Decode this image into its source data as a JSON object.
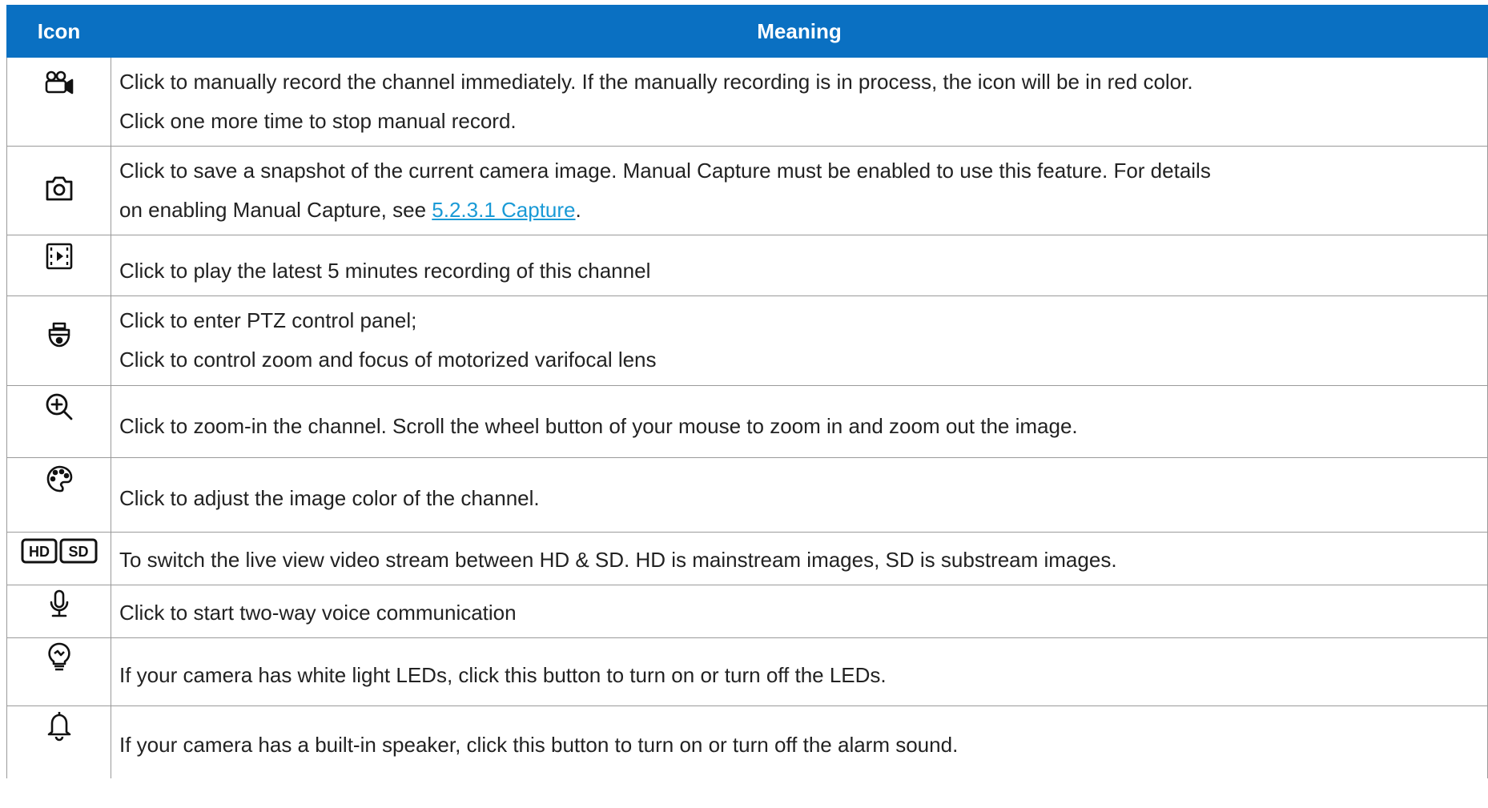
{
  "table": {
    "headers": {
      "icon": "Icon",
      "meaning": "Meaning"
    },
    "rows": [
      {
        "icon": "record-camera-icon",
        "line1": "Click to manually record the channel immediately. If the manually recording is in process, the icon will be in red color.",
        "line2": "Click one more time to stop manual record."
      },
      {
        "icon": "snapshot-camera-icon",
        "line1": "Click to save a snapshot of the current camera image. Manual Capture must be enabled to use this feature. For details",
        "line2_pre": "on enabling Manual Capture, see ",
        "line2_link": "5.2.3.1 Capture",
        "line2_post": "."
      },
      {
        "icon": "playback-icon",
        "line1": "Click to play the latest 5 minutes recording of this channel"
      },
      {
        "icon": "ptz-dome-icon",
        "line1": "Click to enter PTZ control panel;",
        "line2": "Click to control zoom and focus of motorized varifocal lens"
      },
      {
        "icon": "zoom-in-icon",
        "line1": "Click to zoom-in the channel. Scroll the wheel button of your mouse to zoom in and zoom out the image."
      },
      {
        "icon": "color-palette-icon",
        "line1": "Click to adjust the image color of the channel."
      },
      {
        "icon": "hd-sd-icon",
        "icon_text_hd": "HD",
        "icon_text_sd": "SD",
        "line1": "To switch the live view video stream between HD & SD. HD is mainstream images, SD is substream images."
      },
      {
        "icon": "microphone-icon",
        "line1": "Click to start two-way voice communication"
      },
      {
        "icon": "light-bulb-icon",
        "line1": "If your camera has white light LEDs, click this button to turn on or turn off the LEDs."
      },
      {
        "icon": "alarm-bell-icon",
        "line1": "If your camera has a built-in speaker, click this button to turn on or turn off the alarm sound."
      }
    ]
  },
  "colors": {
    "header_bg": "#0a70c2",
    "link": "#1a9ad6",
    "border": "#9a9a9a"
  }
}
